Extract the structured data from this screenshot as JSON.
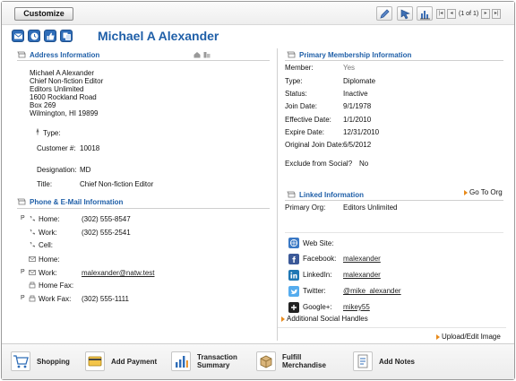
{
  "toolbar": {
    "customize_label": "Customize",
    "icons": [
      "edit-icon",
      "cursor-icon",
      "chart-icon"
    ],
    "pager_text": "(1 of 1)"
  },
  "header": {
    "name": "Michael A Alexander",
    "icons": [
      "email-icon",
      "history-icon",
      "thumbs-up-icon",
      "copy-icon"
    ]
  },
  "address": {
    "title": "Address Information",
    "lines": [
      "Michael A Alexander",
      "Chief Non-fiction Editor",
      "Editors Unlimited",
      "1600 Rockland Road",
      "Box 269",
      "Wilmington, HI 19899"
    ],
    "type_label": "Type:",
    "customer_label": "Customer #:",
    "customer_value": "10018",
    "designation_label": "Designation:",
    "designation_value": "MD",
    "title_label": "Title:",
    "title_value": "Chief Non-fiction Editor"
  },
  "phone": {
    "title": "Phone & E-Mail Information",
    "rows": [
      {
        "p": "P",
        "label": "Home:",
        "value": "(302) 555-8547"
      },
      {
        "p": "",
        "label": "Work:",
        "value": "(302) 555-2541"
      },
      {
        "p": "",
        "label": "Cell:",
        "value": ""
      },
      {
        "p": "",
        "label": "Home:",
        "value": ""
      },
      {
        "p": "P",
        "label": "Work:",
        "value": "malexander@natw.test"
      },
      {
        "p": "",
        "label": "Home Fax:",
        "value": ""
      },
      {
        "p": "P",
        "label": "Work Fax:",
        "value": "(302) 555-1111"
      }
    ]
  },
  "membership": {
    "title": "Primary Membership Information",
    "rows": [
      {
        "label": "Member:",
        "value": "Yes"
      },
      {
        "label": "Type:",
        "value": "Diplomate"
      },
      {
        "label": "Status:",
        "value": "Inactive"
      },
      {
        "label": "Join Date:",
        "value": "9/1/1978"
      },
      {
        "label": "Effective Date:",
        "value": "1/1/2010"
      },
      {
        "label": "Expire Date:",
        "value": "12/31/2010"
      },
      {
        "label": "Original Join Date:",
        "value": "6/5/2012"
      }
    ],
    "exclude_label": "Exclude from Social?",
    "exclude_value": "No"
  },
  "linked": {
    "title": "Linked Information",
    "go_to_org": "Go To Org",
    "primary_org_label": "Primary Org:",
    "primary_org_value": "Editors Unlimited",
    "social": [
      {
        "label": "Web Site:",
        "value": "",
        "icon": "website-icon",
        "color": "#3a78c4"
      },
      {
        "label": "Facebook:",
        "value": "malexander",
        "icon": "facebook-icon",
        "color": "#3b5998"
      },
      {
        "label": "LinkedIn:",
        "value": "malexander",
        "icon": "linkedin-icon",
        "color": "#1f77b4"
      },
      {
        "label": "Twitter:",
        "value": "@mike_alexander",
        "icon": "twitter-icon",
        "color": "#55acee"
      },
      {
        "label": "Google+:",
        "value": "mikey55",
        "icon": "google-plus-icon",
        "color": "#222222"
      }
    ],
    "additional_handles": "Additional Social Handles",
    "upload_image": "Upload/Edit Image"
  },
  "bottom": {
    "items": [
      {
        "label1": "Shopping",
        "label2": "",
        "icon": "shopping-cart-icon"
      },
      {
        "label1": "Add Payment",
        "label2": "",
        "icon": "credit-card-icon"
      },
      {
        "label1": "Transaction",
        "label2": "Summary",
        "icon": "bar-chart-icon"
      },
      {
        "label1": "Fulfill",
        "label2": "Merchandise",
        "icon": "box-icon"
      },
      {
        "label1": "Add Notes",
        "label2": "",
        "icon": "notes-icon"
      }
    ]
  },
  "colors": {
    "accent": "#1f5fa8",
    "orange": "#e88a1a"
  }
}
